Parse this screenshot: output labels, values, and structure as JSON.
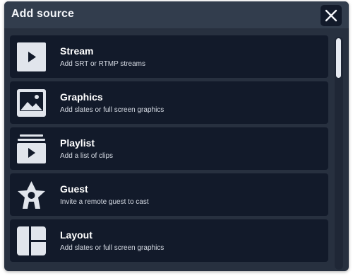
{
  "dialog": {
    "title": "Add source",
    "close_icon": "close-icon"
  },
  "sources": [
    {
      "title": "Stream",
      "subtitle": "Add SRT or RTMP streams",
      "icon": "play-icon"
    },
    {
      "title": "Graphics",
      "subtitle": "Add slates or full screen graphics",
      "icon": "image-icon"
    },
    {
      "title": "Playlist",
      "subtitle": "Add a list of clips",
      "icon": "playlist-icon"
    },
    {
      "title": "Guest",
      "subtitle": "Invite a remote guest to cast",
      "icon": "guest-icon"
    },
    {
      "title": "Layout",
      "subtitle": "Add slates or full screen graphics",
      "icon": "layout-icon"
    }
  ],
  "colors": {
    "panel": "#27303f",
    "header": "#323d4d",
    "item_bg": "#121a2a",
    "icon_fill": "#e1e5ec"
  }
}
